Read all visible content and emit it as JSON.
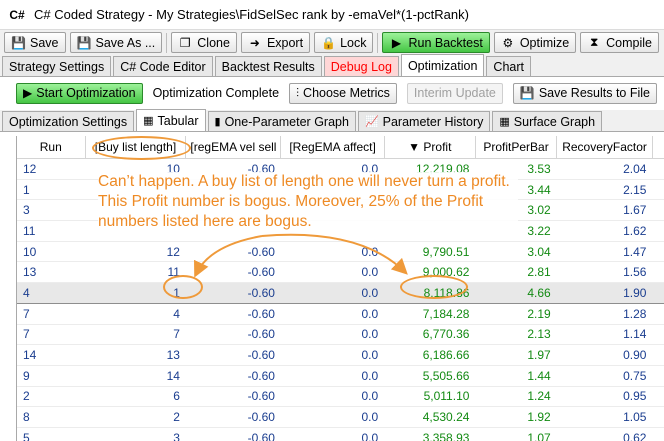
{
  "window": {
    "icon_text": "C#",
    "title": "C# Coded Strategy - My Strategies\\FidSelSec rank by -emaVel*(1-pctRank)"
  },
  "toolbar": {
    "save": "Save",
    "save_as": "Save As ...",
    "clone": "Clone",
    "export": "Export",
    "lock": "Lock",
    "run_backtest": "Run Backtest",
    "optimize": "Optimize",
    "compile": "Compile"
  },
  "main_tabs": {
    "strategy_settings": "Strategy Settings",
    "code_editor": "C# Code Editor",
    "backtest_results": "Backtest Results",
    "debug_log": "Debug Log",
    "optimization": "Optimization",
    "chart": "Chart"
  },
  "optbar": {
    "start": "Start Optimization",
    "status": "Optimization Complete",
    "choose_metrics": "Choose Metrics",
    "interim_update": "Interim Update",
    "save_results": "Save Results to File"
  },
  "sub_tabs": {
    "settings": "Optimization Settings",
    "tabular": "Tabular",
    "one_param": "One-Parameter Graph",
    "history": "Parameter History",
    "surface": "Surface Graph"
  },
  "table": {
    "headers": {
      "run": "Run",
      "buy_list": "[Buy list length]",
      "vel_sell": "[regEMA vel sell",
      "affect": "[RegEMA affect]",
      "profit": "Profit",
      "profit_per_bar": "ProfitPerBar",
      "recovery": "RecoveryFactor"
    },
    "sort_indicator": "▼",
    "rows": [
      {
        "run": "12",
        "buy": "10",
        "vel": "-0.60",
        "aff": "0.0",
        "profit": "12,219.08",
        "ppb": "3.53",
        "rf": "2.04"
      },
      {
        "run": "1",
        "buy": "",
        "vel": "",
        "aff": "",
        "profit": "",
        "ppb": "3.44",
        "rf": "2.15"
      },
      {
        "run": "3",
        "buy": "",
        "vel": "",
        "aff": "",
        "profit": "",
        "ppb": "3.02",
        "rf": "1.67"
      },
      {
        "run": "11",
        "buy": "",
        "vel": "",
        "aff": "",
        "profit": "",
        "ppb": "3.22",
        "rf": "1.62"
      },
      {
        "run": "10",
        "buy": "12",
        "vel": "-0.60",
        "aff": "0.0",
        "profit": "9,790.51",
        "ppb": "3.04",
        "rf": "1.47"
      },
      {
        "run": "13",
        "buy": "11",
        "vel": "-0.60",
        "aff": "0.0",
        "profit": "9,000.62",
        "ppb": "2.81",
        "rf": "1.56"
      },
      {
        "run": "4",
        "buy": "1",
        "vel": "-0.60",
        "aff": "0.0",
        "profit": "8,118.86",
        "ppb": "4.66",
        "rf": "1.90"
      },
      {
        "run": "7",
        "buy": "4",
        "vel": "-0.60",
        "aff": "0.0",
        "profit": "7,184.28",
        "ppb": "2.19",
        "rf": "1.28"
      },
      {
        "run": "7",
        "buy": "7",
        "vel": "-0.60",
        "aff": "0.0",
        "profit": "6,770.36",
        "ppb": "2.13",
        "rf": "1.14"
      },
      {
        "run": "14",
        "buy": "13",
        "vel": "-0.60",
        "aff": "0.0",
        "profit": "6,186.66",
        "ppb": "1.97",
        "rf": "0.90"
      },
      {
        "run": "9",
        "buy": "14",
        "vel": "-0.60",
        "aff": "0.0",
        "profit": "5,505.66",
        "ppb": "1.44",
        "rf": "0.75"
      },
      {
        "run": "2",
        "buy": "6",
        "vel": "-0.60",
        "aff": "0.0",
        "profit": "5,011.10",
        "ppb": "1.24",
        "rf": "0.95"
      },
      {
        "run": "8",
        "buy": "2",
        "vel": "-0.60",
        "aff": "0.0",
        "profit": "4,530.24",
        "ppb": "1.92",
        "rf": "1.05"
      },
      {
        "run": "5",
        "buy": "3",
        "vel": "-0.60",
        "aff": "0.0",
        "profit": "3,358.93",
        "ppb": "1.07",
        "rf": "0.62"
      }
    ]
  },
  "annotation": {
    "text": "Can’t happen. A buy list of length one will never turn a profit. This Profit number is bogus. Moreover, 25% of the Profit numbers listed here are bogus.",
    "color": "#ee8a24"
  },
  "colors": {
    "run_backtest_bg": "#45c544",
    "debug_tab_text": "#ff0000",
    "value_blue": "#1a3d8f",
    "value_green": "#138a13"
  }
}
